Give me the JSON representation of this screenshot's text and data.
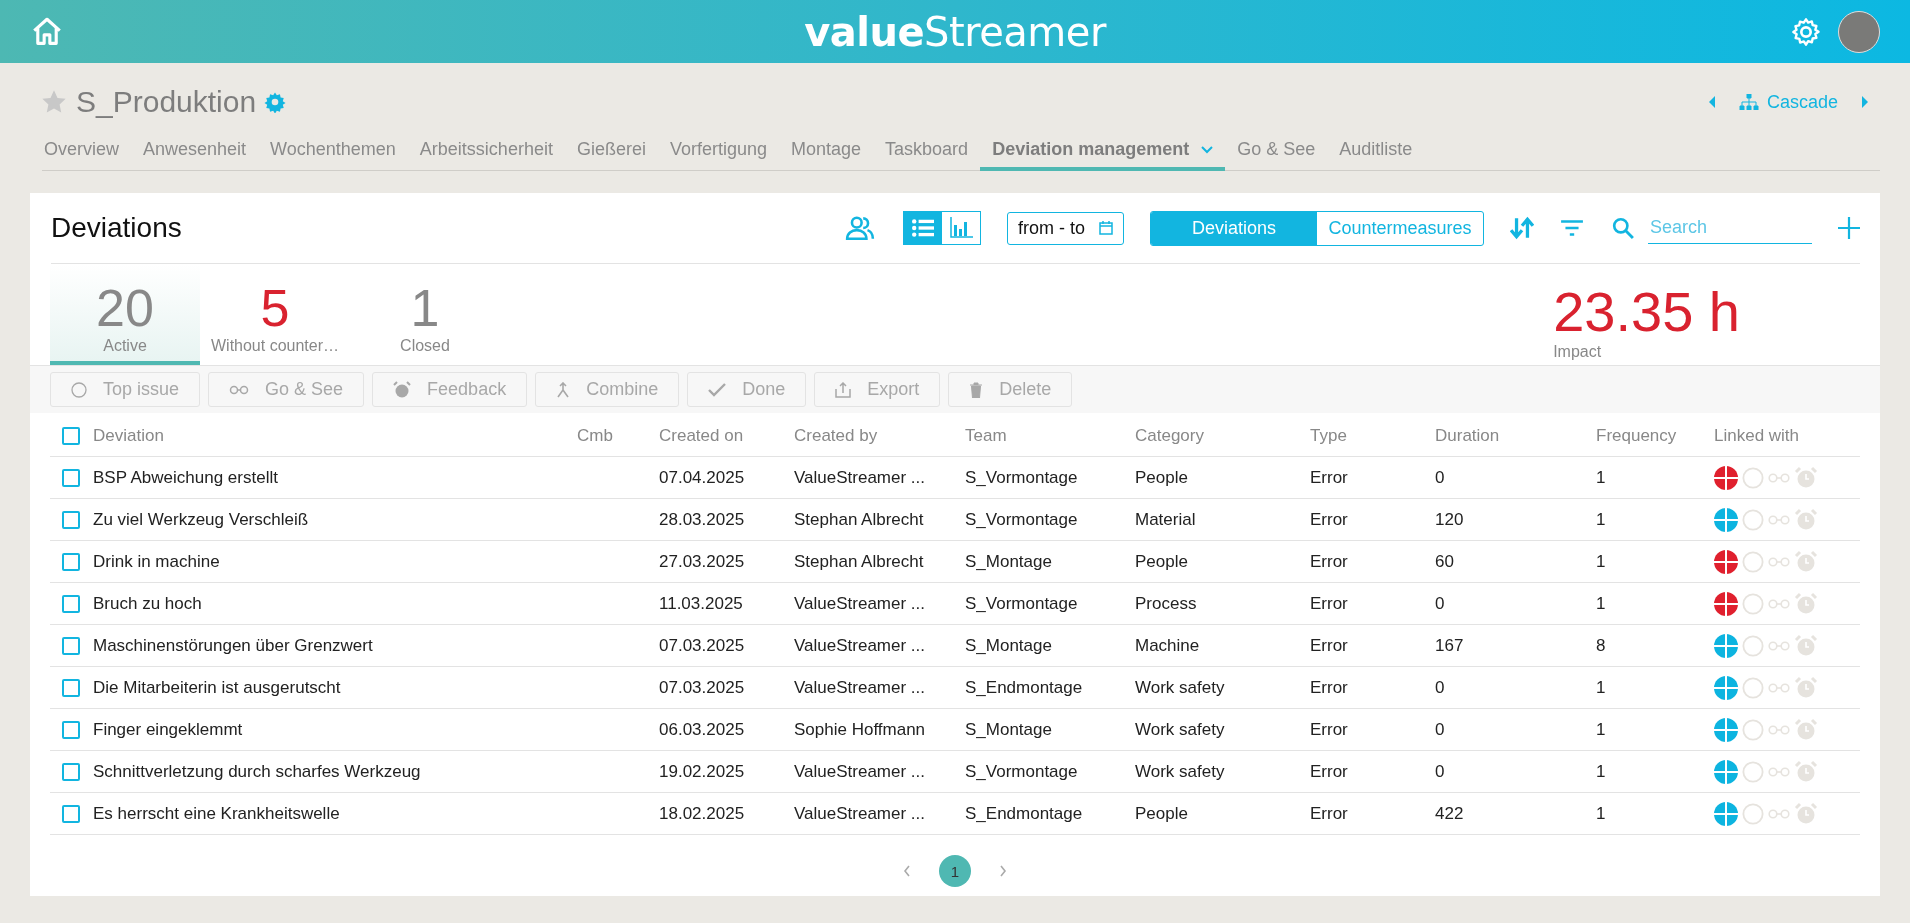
{
  "header": {
    "logo_bold": "value",
    "logo_rest": "Streamer"
  },
  "board": {
    "title": "S_Produktion",
    "favorite": false,
    "cascade": "Cascade"
  },
  "tabs": [
    {
      "label": "Overview",
      "selected": false,
      "dropdown": false
    },
    {
      "label": "Anwesenheit",
      "selected": false,
      "dropdown": false
    },
    {
      "label": "Wochenthemen",
      "selected": false,
      "dropdown": false
    },
    {
      "label": "Arbeitssicherheit",
      "selected": false,
      "dropdown": false
    },
    {
      "label": "Gießerei",
      "selected": false,
      "dropdown": false
    },
    {
      "label": "Vorfertigung",
      "selected": false,
      "dropdown": false
    },
    {
      "label": "Montage",
      "selected": false,
      "dropdown": false
    },
    {
      "label": "Taskboard",
      "selected": false,
      "dropdown": false
    },
    {
      "label": "Deviation management",
      "selected": true,
      "dropdown": true
    },
    {
      "label": "Go & See",
      "selected": false,
      "dropdown": false
    },
    {
      "label": "Auditliste",
      "selected": false,
      "dropdown": false
    }
  ],
  "panel": {
    "title": "Deviations",
    "views": [
      {
        "kind": "list",
        "selected": true
      },
      {
        "kind": "chart",
        "selected": false
      }
    ],
    "date_range": "from - to",
    "segments": [
      {
        "label": "Deviations",
        "selected": true
      },
      {
        "label": "Countermeasures",
        "selected": false
      }
    ],
    "search": {
      "placeholder": "Search"
    }
  },
  "stats": [
    {
      "value": "20",
      "label": "Active",
      "selected": true,
      "alert": false
    },
    {
      "value": "5",
      "label": "Without counter…",
      "selected": false,
      "alert": true
    },
    {
      "value": "1",
      "label": "Closed",
      "selected": false,
      "alert": false
    }
  ],
  "impact": {
    "value": "23.35 h",
    "label": "Impact"
  },
  "actions": [
    {
      "kind": "topissue",
      "label": "Top issue",
      "disabled": true
    },
    {
      "kind": "gosee",
      "label": "Go & See",
      "disabled": true
    },
    {
      "kind": "feedback",
      "label": "Feedback",
      "disabled": true
    },
    {
      "kind": "combine",
      "label": "Combine",
      "disabled": true
    },
    {
      "kind": "done",
      "label": "Done",
      "disabled": true
    },
    {
      "kind": "export",
      "label": "Export",
      "disabled": true
    },
    {
      "kind": "delete",
      "label": "Delete",
      "disabled": true
    }
  ],
  "table": {
    "select_all": false,
    "columns": [
      "Deviation",
      "Cmb",
      "Created on",
      "Created by",
      "Team",
      "Category",
      "Type",
      "Duration",
      "Frequency",
      "Linked with"
    ],
    "rows": [
      {
        "checked": false,
        "deviation": "BSP Abweichung erstellt",
        "created_on": "07.04.2025",
        "created_by": "ValueStreamer ...",
        "team": "S_Vormontage",
        "category": "People",
        "type": "Error",
        "duration": "0",
        "frequency": "1",
        "color": "#e0202e"
      },
      {
        "checked": false,
        "deviation": "Zu viel Werkzeug Verschleiß",
        "created_on": "28.03.2025",
        "created_by": "Stephan Albrecht",
        "team": "S_Vormontage",
        "category": "Material",
        "type": "Error",
        "duration": "120",
        "frequency": "1",
        "color": "#0db4e0"
      },
      {
        "checked": false,
        "deviation": "Drink in machine",
        "created_on": "27.03.2025",
        "created_by": "Stephan Albrecht",
        "team": "S_Montage",
        "category": "People",
        "type": "Error",
        "duration": "60",
        "frequency": "1",
        "color": "#e0202e"
      },
      {
        "checked": false,
        "deviation": "Bruch zu hoch",
        "created_on": "11.03.2025",
        "created_by": "ValueStreamer ...",
        "team": "S_Vormontage",
        "category": "Process",
        "type": "Error",
        "duration": "0",
        "frequency": "1",
        "color": "#e0202e"
      },
      {
        "checked": false,
        "deviation": "Maschinenstörungen über Grenzwert",
        "created_on": "07.03.2025",
        "created_by": "ValueStreamer ...",
        "team": "S_Montage",
        "category": "Machine",
        "type": "Error",
        "duration": "167",
        "frequency": "8",
        "color": "#0db4e0"
      },
      {
        "checked": false,
        "deviation": "Die Mitarbeiterin ist ausgerutscht",
        "created_on": "07.03.2025",
        "created_by": "ValueStreamer ...",
        "team": "S_Endmontage",
        "category": "Work safety",
        "type": "Error",
        "duration": "0",
        "frequency": "1",
        "color": "#0db4e0"
      },
      {
        "checked": false,
        "deviation": "Finger eingeklemmt",
        "created_on": "06.03.2025",
        "created_by": "Sophie Hoffmann",
        "team": "S_Montage",
        "category": "Work safety",
        "type": "Error",
        "duration": "0",
        "frequency": "1",
        "color": "#0db4e0"
      },
      {
        "checked": false,
        "deviation": "Schnittverletzung durch scharfes Werkzeug",
        "created_on": "19.02.2025",
        "created_by": "ValueStreamer ...",
        "team": "S_Vormontage",
        "category": "Work safety",
        "type": "Error",
        "duration": "0",
        "frequency": "1",
        "color": "#0db4e0"
      },
      {
        "checked": false,
        "deviation": "Es herrscht eine Krankheitswelle",
        "created_on": "18.02.2025",
        "created_by": "ValueStreamer ...",
        "team": "S_Endmontage",
        "category": "People",
        "type": "Error",
        "duration": "422",
        "frequency": "1",
        "color": "#0db4e0"
      }
    ]
  },
  "pagination": {
    "pages": [
      {
        "label": "1",
        "selected": true
      }
    ]
  }
}
